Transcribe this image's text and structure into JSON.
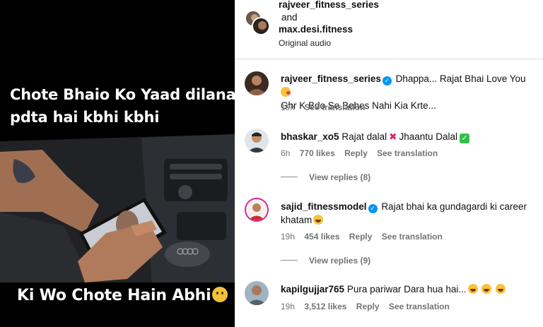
{
  "video": {
    "caption_top": "Chote Bhaio Ko Yaad dilana pdta hai kbhi kbhi",
    "caption_bottom": "Ki Wo Chote Hain Abhi"
  },
  "header": {
    "user1": "rajveer_fitness_series",
    "connector": "and",
    "user2": "max.desi.fitness",
    "audio": "Original audio"
  },
  "comments": [
    {
      "username": "rajveer_fitness_series",
      "verified": true,
      "text_line1": "Dhappa... Rajat Bhai Love You",
      "text_line2": "Ghr K Bdo Se Behes Nahi Kia Krte...",
      "time": "19h",
      "see_translation": "See translation"
    },
    {
      "username": "bhaskar_xo5",
      "text_a": "Rajat dalal",
      "text_b": "Jhaantu Dalal",
      "time": "6h",
      "likes": "770 likes",
      "reply": "Reply",
      "see_translation": "See translation",
      "view_replies": "View replies (8)"
    },
    {
      "username": "sajid_fitnessmodel",
      "verified": true,
      "text_line1": "Rajat bhai ka gundagardi ki career",
      "text_line2": "khatam",
      "time": "19h",
      "likes": "454 likes",
      "reply": "Reply",
      "see_translation": "See translation",
      "view_replies": "View replies (9)"
    },
    {
      "username": "kapilgujjar765",
      "text": "Pura pariwar Dara hua hai...",
      "time": "19h",
      "likes": "3,512 likes",
      "reply": "Reply",
      "see_translation": "See translation"
    }
  ]
}
